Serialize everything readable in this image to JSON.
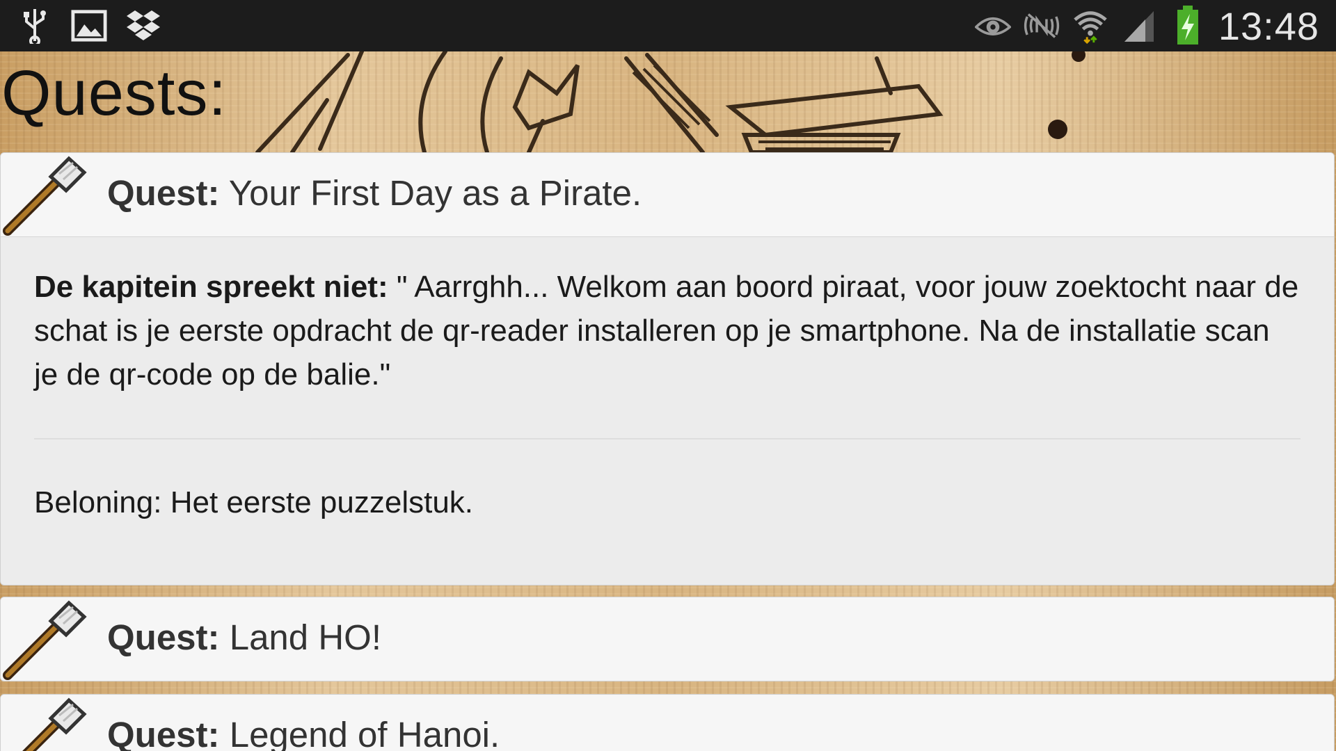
{
  "status_bar": {
    "left_icons": [
      "usb-icon",
      "image-icon",
      "dropbox-icon"
    ],
    "right_icons": [
      "eye-icon",
      "nfc-off-icon",
      "wifi-icon",
      "signal-icon",
      "battery-charging-icon"
    ],
    "time": "13:48"
  },
  "page": {
    "title": "Quests:"
  },
  "quests": [
    {
      "label": "Quest:",
      "title": "Your First Day as a Pirate.",
      "expanded": true,
      "speaker": "De kapitein spreekt niet:",
      "text": " \" Aarrghh... Welkom aan boord piraat, voor jouw zoektocht naar de schat is je eerste opdracht de qr-reader installeren op je smartphone. Na de installatie scan je de qr-code op de balie.\"",
      "reward": "Beloning: Het eerste puzzelstuk."
    },
    {
      "label": "Quest:",
      "title": "Land HO!",
      "expanded": false
    },
    {
      "label": "Quest:",
      "title": "Legend of Hanoi.",
      "expanded": false
    }
  ],
  "colors": {
    "status_bar": "#1c1c1c",
    "card_header": "#f6f6f6",
    "card_body": "#ececec",
    "parchment": "#d9b98a"
  }
}
